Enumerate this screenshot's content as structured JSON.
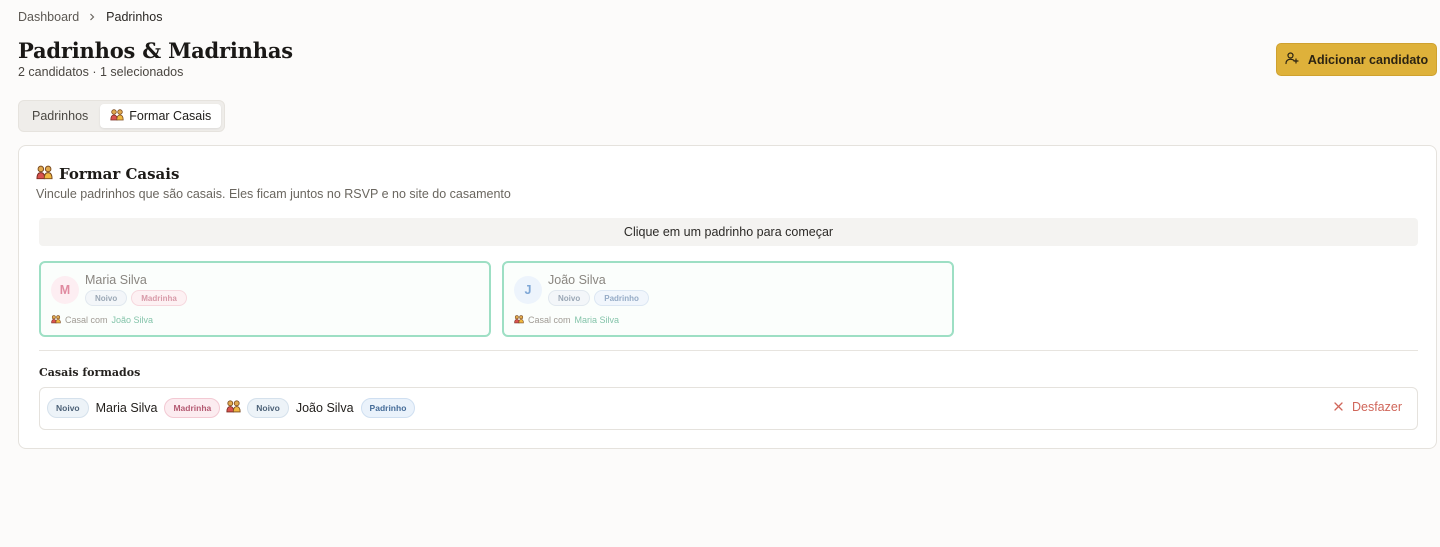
{
  "breadcrumb": {
    "items": [
      "Dashboard",
      "Padrinhos"
    ]
  },
  "header": {
    "title": "Padrinhos & Madrinhas",
    "subtitle": "2 candidatos · 1 selecionados",
    "add_button_label": "Adicionar candidato"
  },
  "tabs": [
    {
      "label": "Padrinhos",
      "active": false
    },
    {
      "label": "Formar Casais",
      "active": true,
      "icon": "couple-icon"
    }
  ],
  "card": {
    "title": "Formar Casais",
    "description": "Vincule padrinhos que são casais. Eles ficam juntos no RSVP e no site do casamento",
    "hint": "Clique em um padrinho para começar",
    "people": [
      {
        "initial": "M",
        "name": "Maria Silva",
        "badges": [
          "Noivo",
          "Madrinha"
        ],
        "couple_prefix": "Casal com",
        "couple_with": "João Silva"
      },
      {
        "initial": "J",
        "name": "João Silva",
        "badges": [
          "Noivo",
          "Padrinho"
        ],
        "couple_prefix": "Casal com",
        "couple_with": "Maria Silva"
      }
    ],
    "formed_label": "Casais formados",
    "formed": [
      {
        "a": {
          "side": "Noivo",
          "name": "Maria Silva",
          "role": "Madrinha"
        },
        "b": {
          "side": "Noivo",
          "name": "João Silva",
          "role": "Padrinho"
        },
        "undo_label": "Desfazer"
      }
    ]
  },
  "colors": {
    "accent": "#deb13a",
    "selected_border": "#9ddfc4",
    "danger": "#d0665a"
  }
}
